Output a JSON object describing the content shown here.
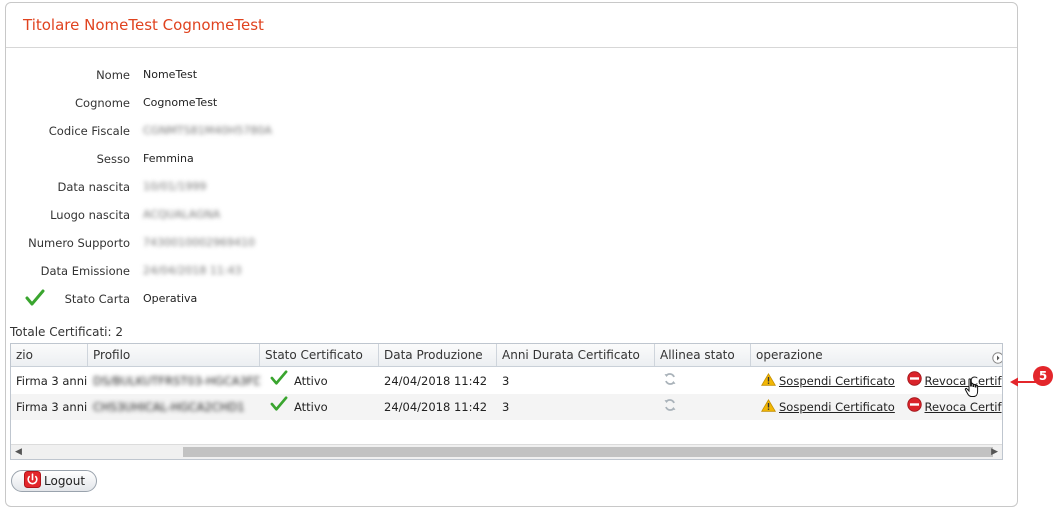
{
  "panel": {
    "title": "Titolare NomeTest CognomeTest"
  },
  "fields": [
    {
      "label": "Nome",
      "value": "NomeTest",
      "blurred": false
    },
    {
      "label": "Cognome",
      "value": "CognomeTest",
      "blurred": false
    },
    {
      "label": "Codice Fiscale",
      "value": "CGNMTS81M40H5780A",
      "blurred": true
    },
    {
      "label": "Sesso",
      "value": "Femmina",
      "blurred": false
    },
    {
      "label": "Data nascita",
      "value": "10/01/1999",
      "blurred": true
    },
    {
      "label": "Luogo nascita",
      "value": "ACQUALAGNA",
      "blurred": true
    },
    {
      "label": "Numero Supporto",
      "value": "7430010002969410",
      "blurred": true
    },
    {
      "label": "Data Emissione",
      "value": "24/04/2018 11:43",
      "blurred": true
    },
    {
      "label": "Stato Carta",
      "value": "Operativa",
      "blurred": false
    }
  ],
  "certificates": {
    "total_label": "Totale Certificati: 2",
    "columns": [
      "zio",
      "Profilo",
      "Stato Certificato",
      "Data Produzione",
      "Anni Durata Certificato",
      "Allinea stato",
      "operazione"
    ],
    "rows": [
      {
        "servizio": "Firma 3 anni",
        "profilo": "DS/BULKUTFRST03-HGCA3FD1",
        "stato": "Attivo",
        "data": "24/04/2018 11:42",
        "anni": "3",
        "sospendi": "Sospendi Certificato",
        "revoca": "Revoca Certif"
      },
      {
        "servizio": "Firma 3 anni",
        "profilo": "CHS3UHICAL-HGCA2CHD1",
        "stato": "Attivo",
        "data": "24/04/2018 11:42",
        "anni": "3",
        "sospendi": "Sospendi Certificato",
        "revoca": "Revoca Certif"
      }
    ]
  },
  "logout": {
    "label": "Logout"
  },
  "annotation": {
    "number": "5"
  },
  "colors": {
    "title": "#e0431f",
    "check": "#3aa52f",
    "warning": "#f2b705",
    "stop": "#d9232a",
    "marker": "#e3262b"
  }
}
